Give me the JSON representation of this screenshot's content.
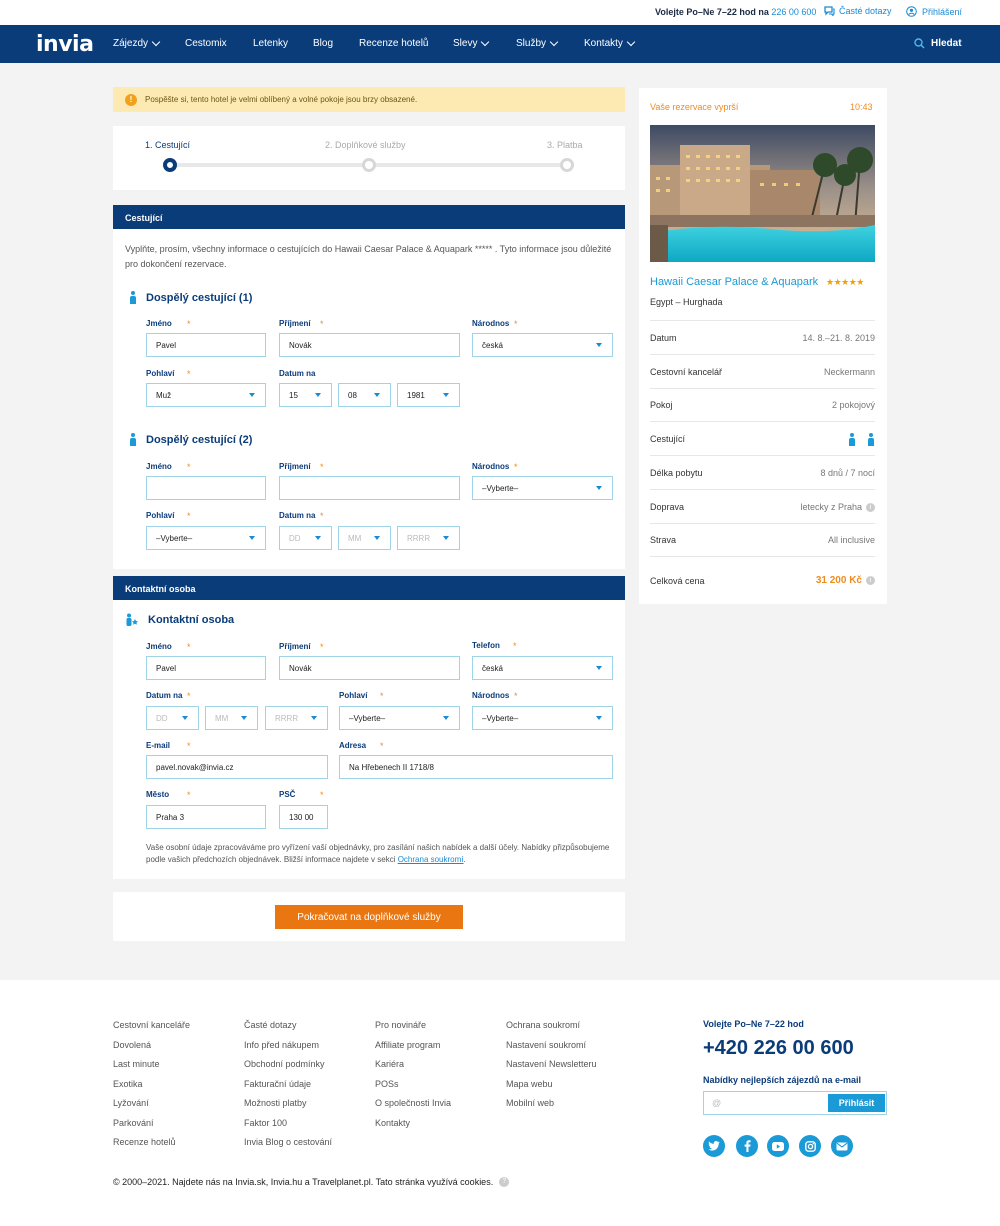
{
  "topbar": {
    "call_text": "Volejte Po–Ne 7–22 hod na",
    "call_phone": "226 00 600",
    "faq": "Časté dotazy",
    "login": "Přihlášení"
  },
  "nav": {
    "logo": "invia",
    "items": [
      "Zájezdy",
      "Cestomix",
      "Letenky",
      "Blog",
      "Recenze hotelů",
      "Slevy",
      "Služby",
      "Kontakty"
    ],
    "search": "Hledat"
  },
  "alert": {
    "icon": "!",
    "text": "Pospěšte si, tento hotel je velmi oblíbený a volné pokoje jsou brzy obsazené."
  },
  "steps": [
    "1. Cestující",
    "2. Doplňkové služby",
    "3. Platba"
  ],
  "travelers": {
    "section_title": "Cestující",
    "intro": "Vyplňte, prosím, všechny informace o cestujících do Hawaii Caesar Palace & Aquapark ***** . Tyto informace jsou důležité pro dokončení rezervace.",
    "labels": {
      "first": "Jméno",
      "last": "Příjmení",
      "nationality": "Národnos",
      "gender": "Pohlaví",
      "dob": "Datum na",
      "req": "*"
    },
    "adult1": {
      "title": "Dospělý cestující (1)",
      "first": "Pavel",
      "last": "Novák",
      "nationality": "česká",
      "gender": "Muž",
      "day": "15",
      "month": "08",
      "year": "1981"
    },
    "adult2": {
      "title": "Dospělý cestující (2)",
      "first": "",
      "last": "",
      "nationality": "–Vyberte–",
      "gender": "–Vyberte–",
      "day": "DD",
      "month": "MM",
      "year": "RRRR"
    }
  },
  "contact": {
    "section_title": "Kontaktní osoba",
    "title": "Kontaktní osoba",
    "labels": {
      "first": "Jméno",
      "last": "Příjmení",
      "phone": "Telefon",
      "dob": "Datum na",
      "gender": "Pohlaví",
      "nationality": "Národnos",
      "email": "E-mail",
      "address": "Adresa",
      "city": "Město",
      "zip": "PSČ"
    },
    "first": "Pavel",
    "last": "Novák",
    "phone": "česká",
    "day": "DD",
    "month": "MM",
    "year": "RRRR",
    "gender": "–Vyberte–",
    "nationality": "–Vyberte–",
    "email": "pavel.novak@invia.cz",
    "address": "Na Hřebenech II 1718/8",
    "city": "Praha 3",
    "zip": "130 00",
    "note": "Vaše osobní údaje zpracováváme pro vyřízení vaší objednávky, pro zasílání našich nabídek a další účely. Nabídky přizpůsobujeme podle vašich předchozích objednávek. Bližší informace najdete v sekci",
    "note_link": "Ochrana soukromí",
    "note_end": "."
  },
  "cta": "Pokračovat na doplňkové služby",
  "sidebar": {
    "expire_label": "Vaše rezervace vyprší",
    "timer": "10:43",
    "hotel": "Hawaii Caesar Palace & Aquapark",
    "stars": "★★★★★",
    "destination": "Egypt – Hurghada",
    "rows": [
      {
        "k": "Datum",
        "v": "14. 8.–21. 8. 2019"
      },
      {
        "k": "Cestovní kancelář",
        "v": "Neckermann"
      },
      {
        "k": "Pokoj",
        "v": "2 pokojový"
      },
      {
        "k": "Cestující",
        "v": ""
      },
      {
        "k": "Délka pobytu",
        "v": "8 dnů / 7 nocí"
      },
      {
        "k": "Doprava",
        "v": "letecky z Praha"
      },
      {
        "k": "Strava",
        "v": "All inclusive"
      }
    ],
    "total_label": "Celková cena",
    "total_value": "31 200 Kč"
  },
  "footer": {
    "col1": [
      "Cestovní kanceláře",
      "Dovolená",
      "Last minute",
      "Exotika",
      "Lyžování",
      "Parkování",
      "Recenze hotelů"
    ],
    "col2": [
      "Časté dotazy",
      "Info před nákupem",
      "Obchodní podmínky",
      "Fakturační údaje",
      "Možnosti platby",
      "Faktor 100",
      "Invia Blog o cestování"
    ],
    "col3": [
      "Pro novináře",
      "Affiliate program",
      "Kariéra",
      "POSs",
      "O společnosti Invia",
      "Kontakty"
    ],
    "col4": [
      "Ochrana soukromí",
      "Nastavení soukromí",
      "Nastavení Newsletteru",
      "Mapa webu",
      "Mobilní web"
    ],
    "call_label": "Volejte Po–Ne 7–22 hod",
    "phone": "+420 226 00 600",
    "newsletter_label": "Nabídky nejlepších zájezdů na e-mail",
    "newsletter_placeholder": "@",
    "subscribe": "Přihlásit",
    "copyright": "© 2000–2021. Najdete nás na Invia.sk, Invia.hu a Travelplanet.pl. Tato stránka využívá cookies.",
    "colors": {
      "brand": "#0b3c7a",
      "accent": "#ea7611",
      "link": "#1a8bd2"
    }
  }
}
